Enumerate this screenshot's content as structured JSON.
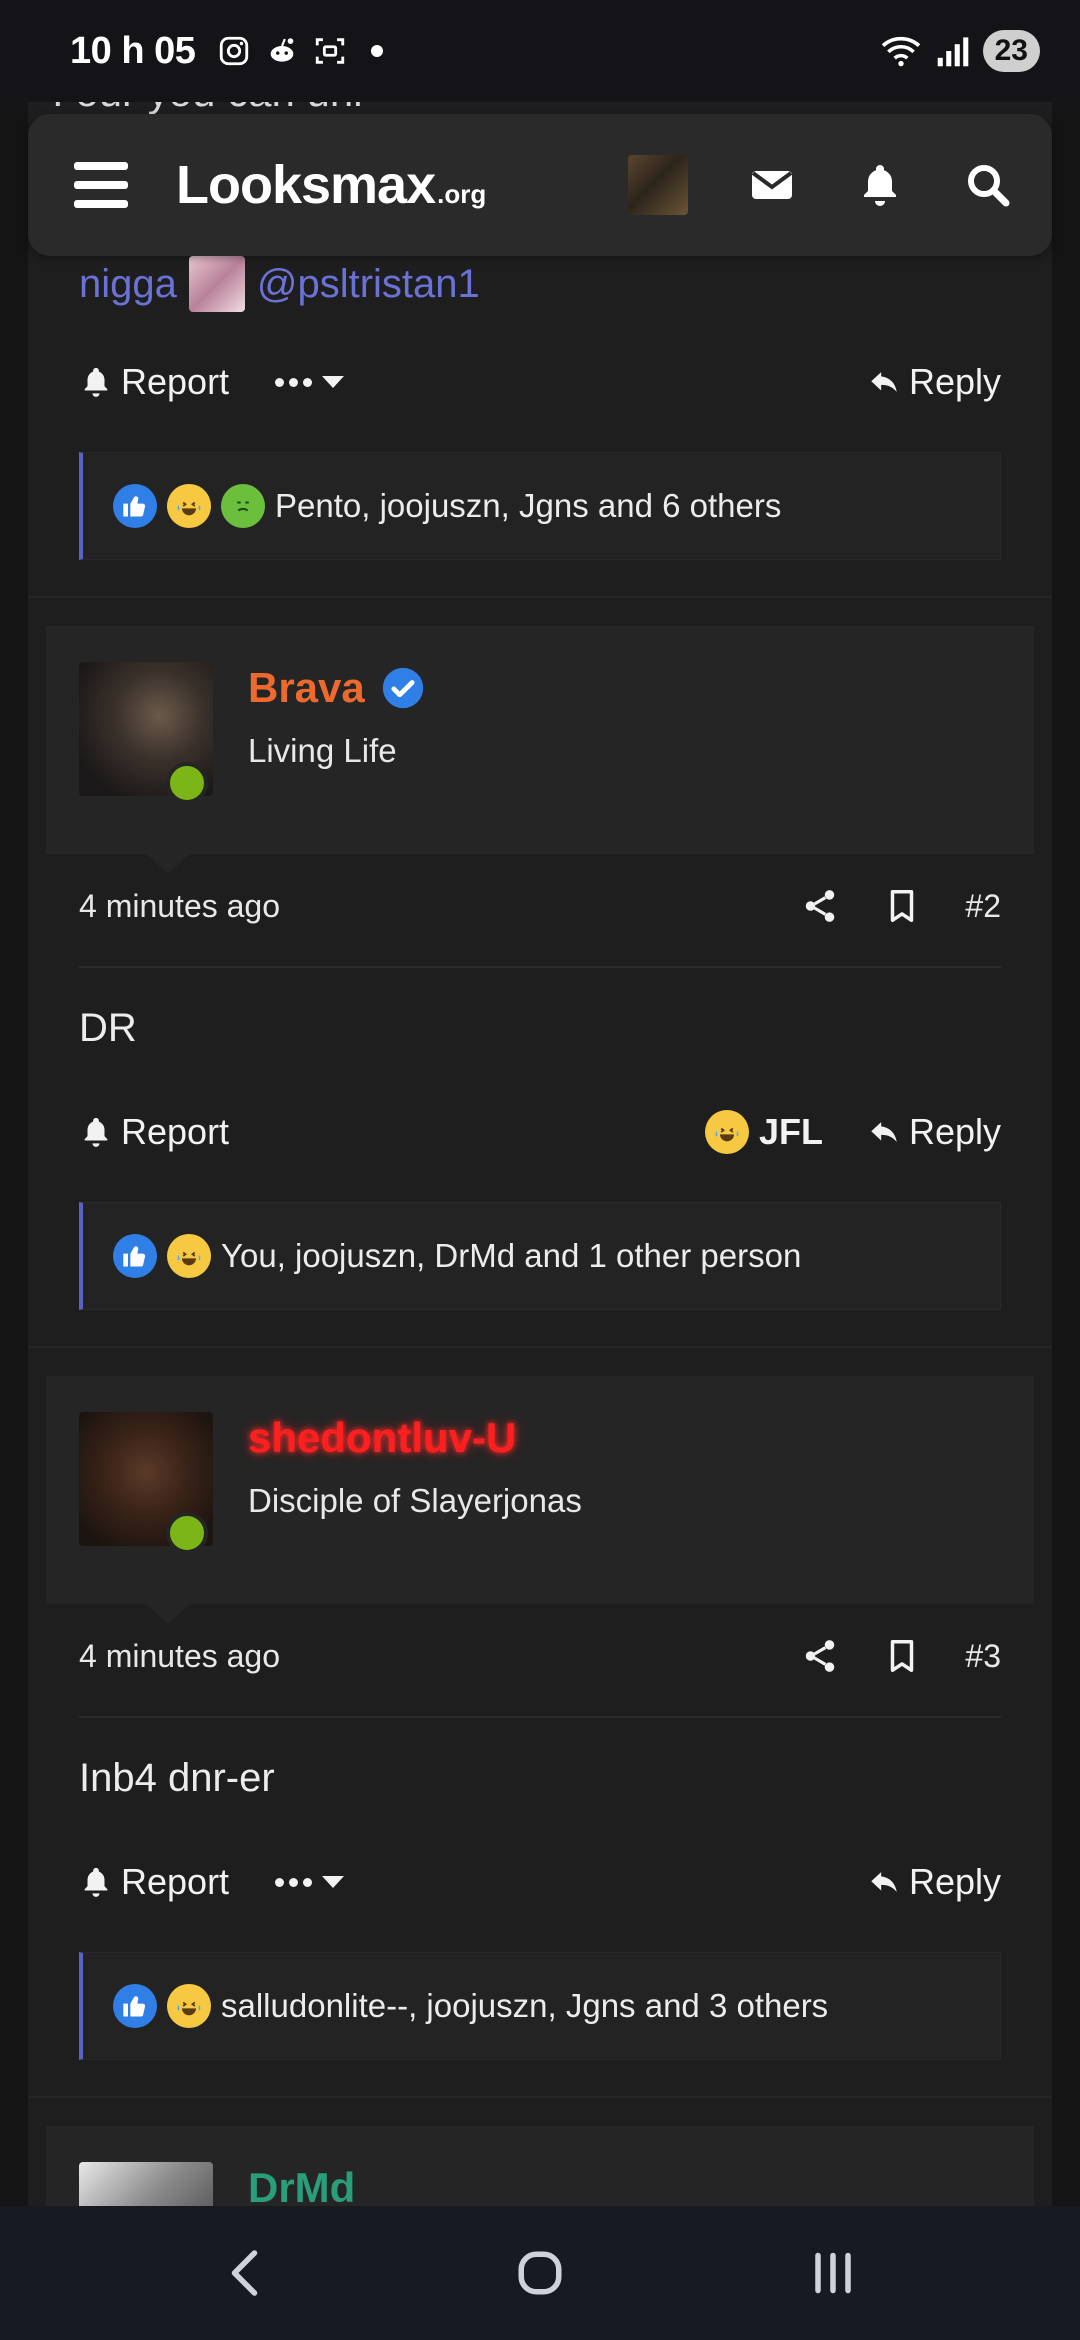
{
  "status_bar": {
    "time": "10 h 05",
    "battery": "23"
  },
  "site": {
    "logo_main": "Looksmax",
    "logo_tld": ".org"
  },
  "clipped_text": "I our you can uni",
  "post1": {
    "mention_word": "nigga",
    "mention_user": "@psltristan1",
    "report_label": "Report",
    "reply_label": "Reply",
    "reactions_text": "Pento, joojuszn, Jgns and 6 others"
  },
  "post2": {
    "username": "Brava",
    "user_title": "Living Life",
    "time": "4 minutes ago",
    "number": "#2",
    "body": "DR",
    "report_label": "Report",
    "jfl_label": "JFL",
    "reply_label": "Reply",
    "reactions_text": "You, joojuszn, DrMd and 1 other person"
  },
  "post3": {
    "username": "shedontluv-U",
    "user_title": "Disciple of Slayerjonas",
    "time": "4 minutes ago",
    "number": "#3",
    "body": "Inb4 dnr-er",
    "report_label": "Report",
    "reply_label": "Reply",
    "reactions_text": "salludonlite--, joojuszn, Jgns and 3 others"
  },
  "post4": {
    "username": "DrMd"
  },
  "colors": {
    "accent_link": "#6b72d6",
    "brava_name": "#ec6a2e",
    "shed_name": "#ff1f1f",
    "drmd_name": "#2a9d7b",
    "online": "#7cb518"
  }
}
